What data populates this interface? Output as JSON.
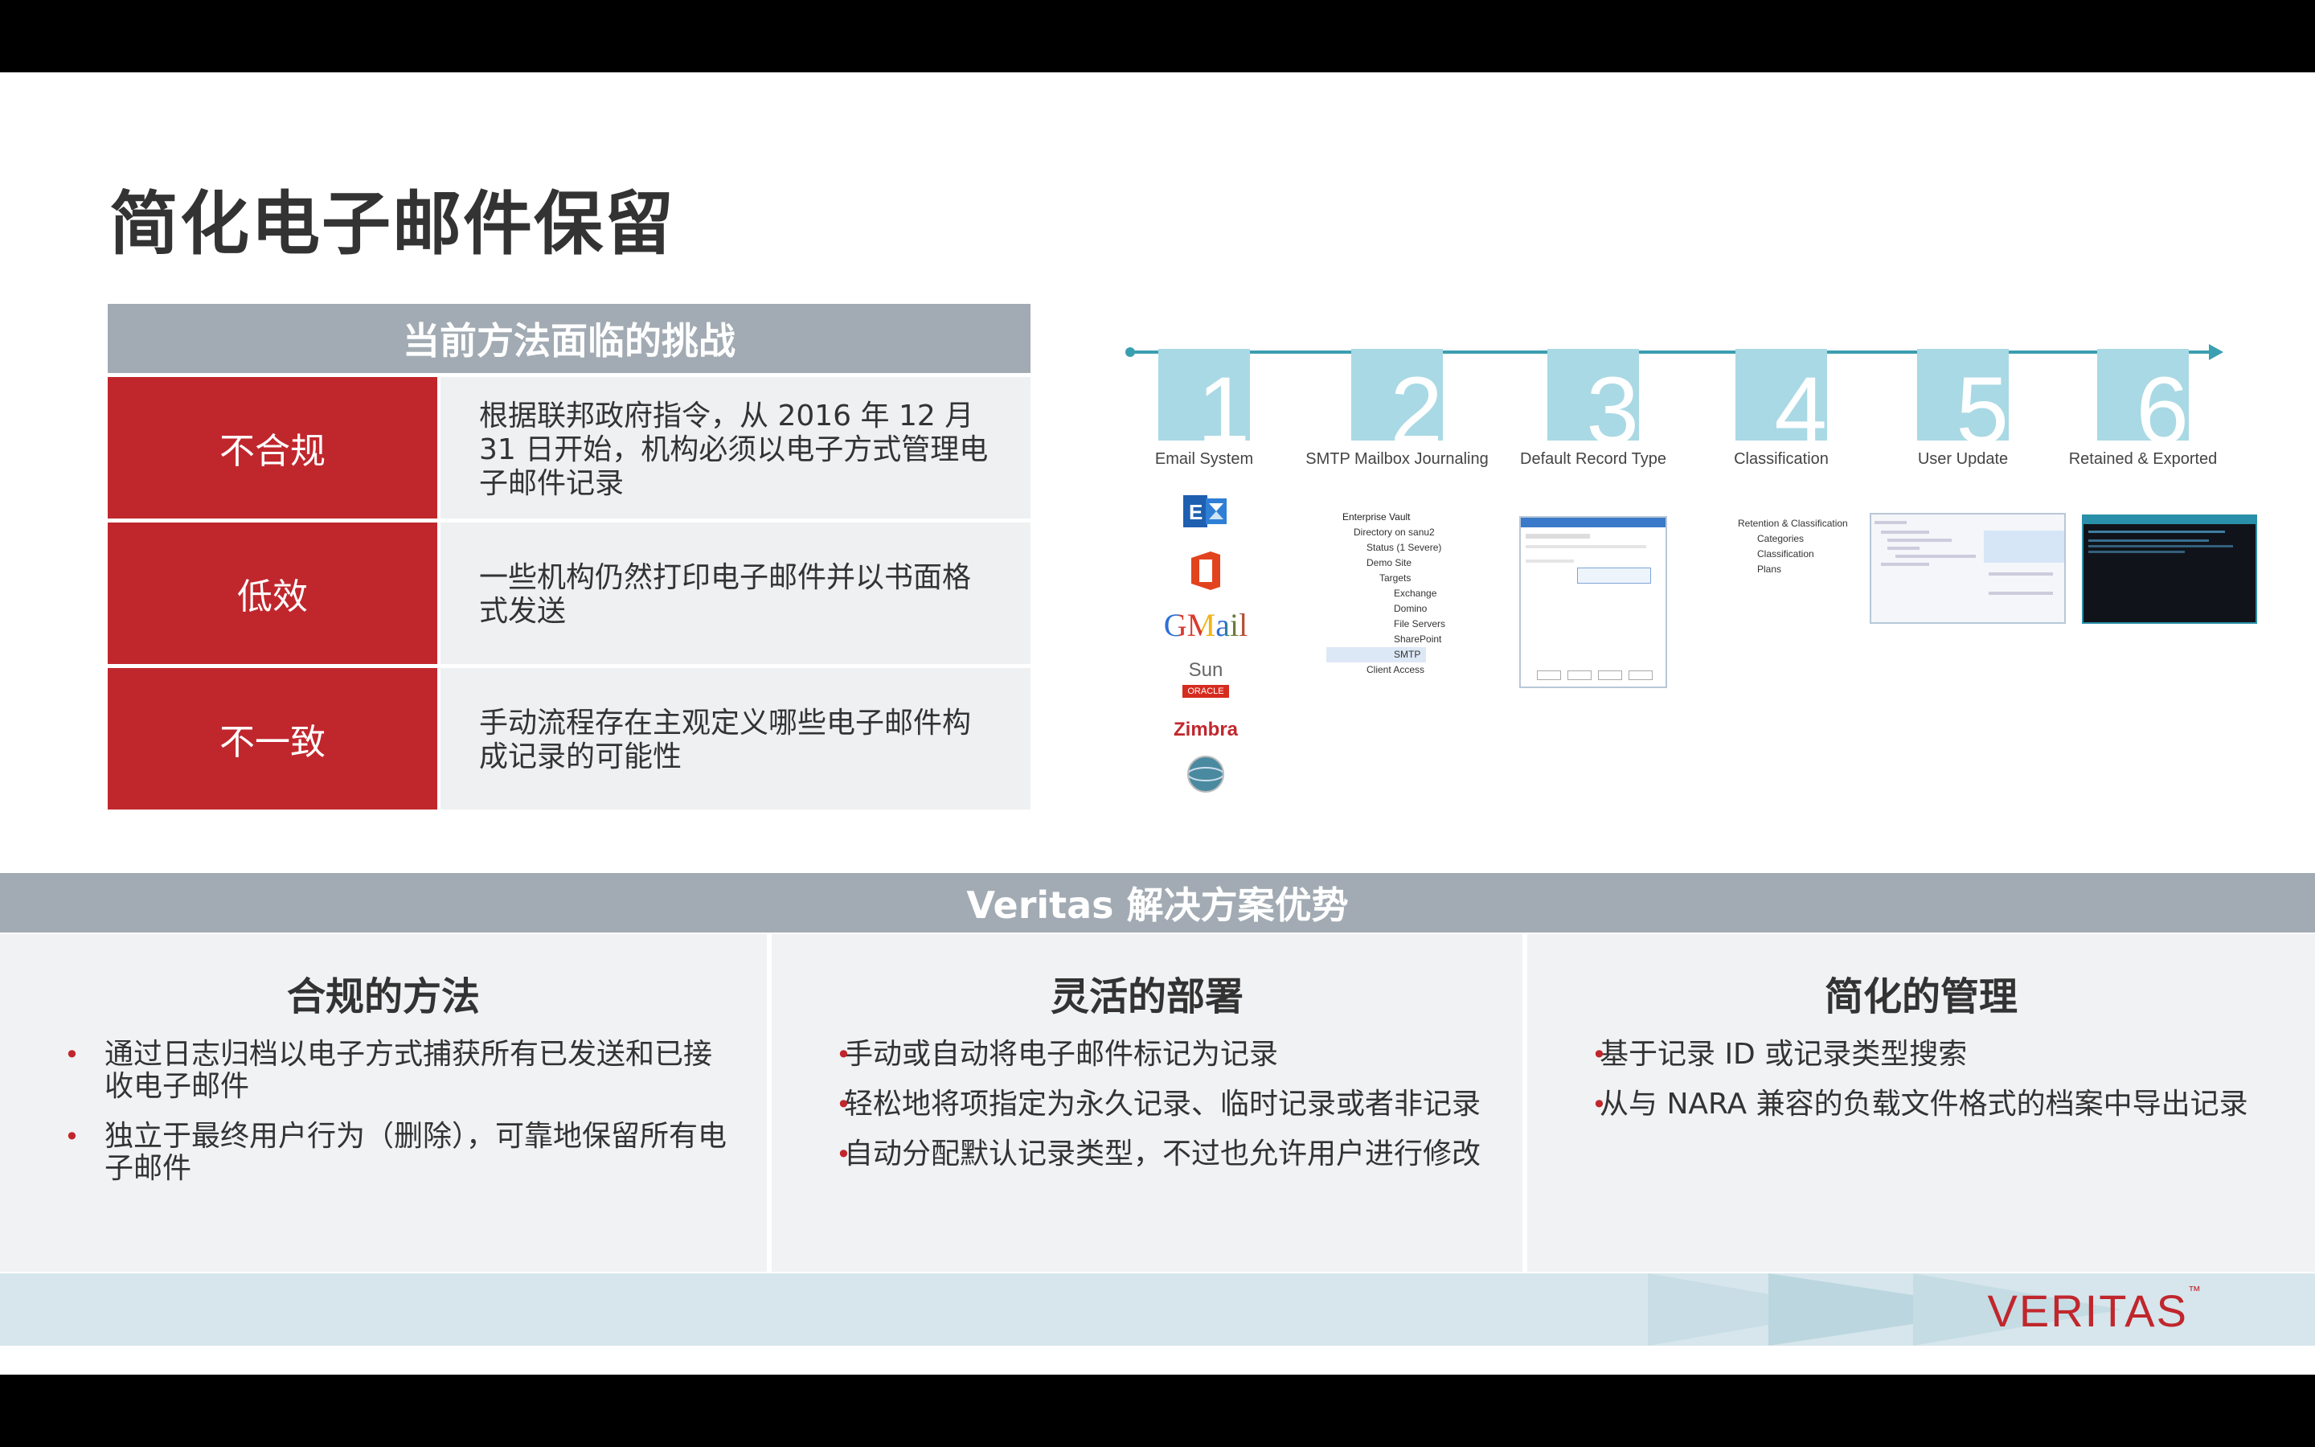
{
  "title": "简化电子邮件保留",
  "challenges": {
    "header": "当前方法面临的挑战",
    "rows": [
      {
        "label": "不合规",
        "text": "根据联邦政府指令，从 2016 年 12 月 31 日开始，机构必须以电子方式管理电子邮件记录"
      },
      {
        "label": "低效",
        "text": "一些机构仍然打印电子邮件并以书面格式发送"
      },
      {
        "label": "不一致",
        "text": "手动流程存在主观定义哪些电子邮件构成记录的可能性"
      }
    ]
  },
  "timeline": {
    "steps": [
      {
        "num": "1",
        "label": "Email System"
      },
      {
        "num": "2",
        "label": "SMTP Mailbox Journaling"
      },
      {
        "num": "3",
        "label": "Default Record Type"
      },
      {
        "num": "4",
        "label": "Classification"
      },
      {
        "num": "5",
        "label": "User Update"
      },
      {
        "num": "6",
        "label": "Retained & Exported"
      }
    ],
    "logos": {
      "gmail": "GMail",
      "sun": "Sun",
      "oracle": "ORACLE",
      "zimbra": "Zimbra"
    },
    "tree2": [
      "Enterprise Vault",
      "Directory on sanu2",
      "Status (1 Severe)",
      "Demo Site",
      "Targets",
      "Exchange",
      "Domino",
      "File Servers",
      "SharePoint",
      "SMTP",
      "Client Access"
    ],
    "tree4": [
      "Retention & Classification",
      "Categories",
      "Classification",
      "Plans"
    ]
  },
  "solution": {
    "header": "Veritas 解决方案优势",
    "columns": [
      {
        "title": "合规的方法",
        "items": [
          "通过日志归档以电子方式捕获所有已发送和已接收电子邮件",
          "独立于最终用户行为（删除），可靠地保留所有电子邮件"
        ]
      },
      {
        "title": "灵活的部署",
        "items": [
          "手动或自动将电子邮件标记为记录",
          "轻松地将项指定为永久记录、临时记录或者非记录",
          "自动分配默认记录类型，不过也允许用户进行修改"
        ]
      },
      {
        "title": "简化的管理",
        "items": [
          "基于记录 ID 或记录类型搜索",
          "从与 NARA 兼容的负载文件格式的档案中导出记录"
        ]
      }
    ]
  },
  "brand": "VERITAS",
  "colors": {
    "red": "#c0272d",
    "gray": "#a2abb3",
    "teal": "#a9d9e4"
  }
}
